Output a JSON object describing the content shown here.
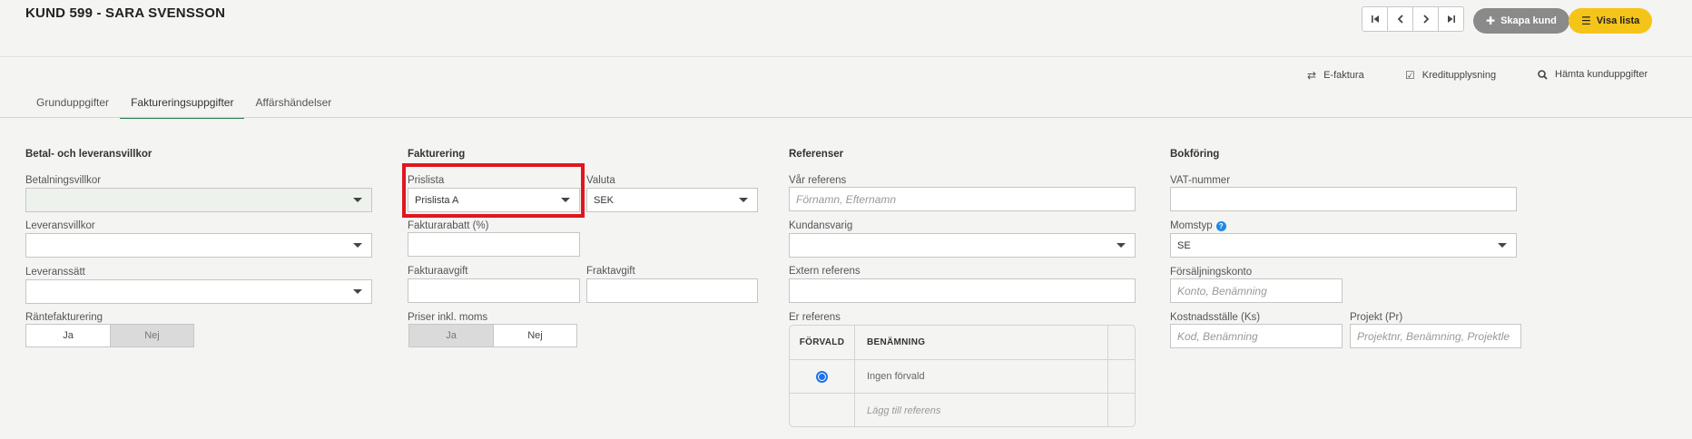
{
  "header": {
    "title": "KUND 599 - SARA SVENSSON",
    "nav": {
      "first_icon": "skip-first-icon",
      "prev_icon": "chevron-left-icon",
      "next_icon": "chevron-right-icon",
      "last_icon": "skip-last-icon"
    },
    "create_label": "Skapa kund",
    "list_label": "Visa lista"
  },
  "toolbar": {
    "efaktura": "E-faktura",
    "kredit": "Kreditupplysning",
    "hamta": "Hämta kunduppgifter"
  },
  "tabs": [
    "Grunduppgifter",
    "Faktureringsuppgifter",
    "Affärshändelser"
  ],
  "active_tab": "Faktureringsuppgifter",
  "betal": {
    "title": "Betal- och leveransvillkor",
    "betalningsvillkor_label": "Betalningsvillkor",
    "betalningsvillkor_value": "",
    "leveransvillkor_label": "Leveransvillkor",
    "leveranssatt_label": "Leveranssätt",
    "rantefakturering_label": "Räntefakturering",
    "ja": "Ja",
    "nej": "Nej",
    "rantefakturering_selected": "Nej"
  },
  "fakturering": {
    "title": "Fakturering",
    "prislista_label": "Prislista",
    "prislista_value": "Prislista A",
    "valuta_label": "Valuta",
    "valuta_value": "SEK",
    "fakturarabatt_label": "Fakturarabatt (%)",
    "fakturaavgift_label": "Fakturaavgift",
    "fraktavgift_label": "Fraktavgift",
    "priser_label": "Priser inkl. moms",
    "ja": "Ja",
    "nej": "Nej",
    "priser_selected": "Nej"
  },
  "referenser": {
    "title": "Referenser",
    "var_referens_label": "Vår referens",
    "var_referens_placeholder": "Förnamn, Efternamn",
    "kundansvarig_label": "Kundansvarig",
    "extern_label": "Extern referens",
    "er_referens_label": "Er referens",
    "table_headers": [
      "FÖRVALD",
      "BENÄMNING"
    ],
    "rows": [
      "Ingen förvald"
    ],
    "add_placeholder": "Lägg till referens"
  },
  "bokforing": {
    "title": "Bokföring",
    "vat_label": "VAT-nummer",
    "momstyp_label": "Momstyp",
    "momstyp_value": "SE",
    "forsaljningskonto_label": "Försäljningskonto",
    "forsaljningskonto_placeholder": "Konto, Benämning",
    "kostnad_label": "Kostnadsställe (Ks)",
    "kostnad_placeholder": "Kod, Benämning",
    "projekt_label": "Projekt (Pr)",
    "projekt_placeholder": "Projektnr, Benämning, Projektle"
  },
  "colors": {
    "accent_yellow": "#f5c418",
    "tab_underline": "#2e7d4f",
    "highlight": "#e0161e",
    "radio": "#1a73e8"
  }
}
